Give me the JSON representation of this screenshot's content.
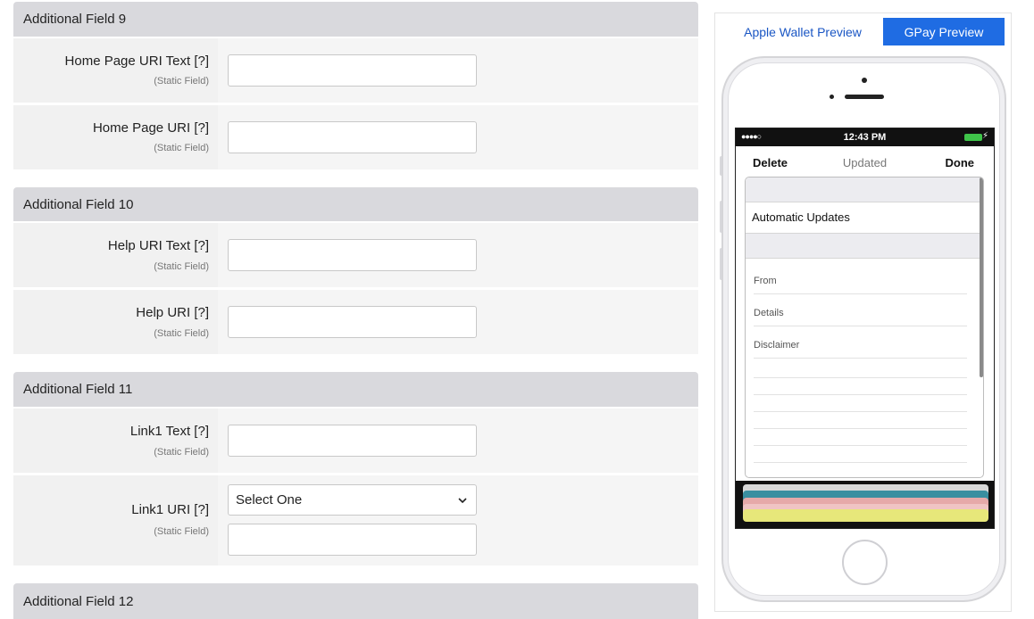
{
  "sections": [
    {
      "title": "Additional Field 9",
      "fields": [
        {
          "label": "Home Page URI Text [?]",
          "sub": "(Static Field)",
          "value": ""
        },
        {
          "label": "Home Page URI [?]",
          "sub": "(Static Field)",
          "value": ""
        }
      ]
    },
    {
      "title": "Additional Field 10",
      "fields": [
        {
          "label": "Help URI Text [?]",
          "sub": "(Static Field)",
          "value": ""
        },
        {
          "label": "Help URI [?]",
          "sub": "(Static Field)",
          "value": ""
        }
      ]
    },
    {
      "title": "Additional Field 11",
      "fields": [
        {
          "label": "Link1 Text [?]",
          "sub": "(Static Field)",
          "value": ""
        },
        {
          "label": "Link1 URI [?]",
          "sub": "(Static Field)",
          "select_value": "Select One",
          "value": ""
        }
      ]
    },
    {
      "title": "Additional Field 12",
      "fields": []
    }
  ],
  "preview": {
    "tabs": [
      {
        "label": "Apple Wallet Preview",
        "active": false
      },
      {
        "label": "GPay Preview",
        "active": true
      }
    ],
    "status_bar": {
      "signal": "●●●●○",
      "time": "12:43 PM",
      "battery_color": "#3fc44a"
    },
    "navbar": {
      "left": "Delete",
      "title": "Updated",
      "right": "Done"
    },
    "back": {
      "toggle_label": "Automatic Updates",
      "fields": [
        "From",
        "Details",
        "Disclaimer"
      ]
    },
    "card_stack_colors": [
      "#d8d8d8",
      "#3a8fa0",
      "#e6a9a9",
      "#f0c4c4",
      "#e7e77a"
    ]
  },
  "colors": {
    "accent": "#1f6ce3",
    "link": "#1a56c4",
    "header_bg": "#d9d9dd"
  }
}
